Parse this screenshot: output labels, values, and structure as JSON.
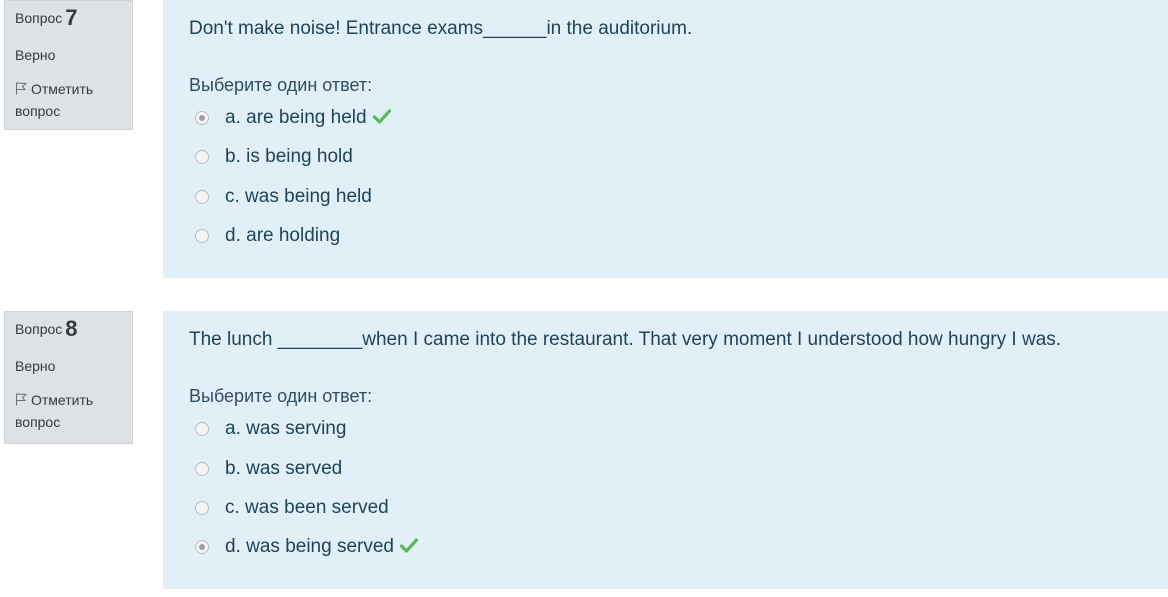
{
  "questions": [
    {
      "label": "Вопрос",
      "number": "7",
      "state": "Верно",
      "flag_label": "Отметить вопрос",
      "text": "Don't make noise! Entrance exams______in the auditorium.",
      "prompt": "Выберите один ответ:",
      "answers": [
        {
          "label": "a. are being held",
          "selected": true,
          "correct": true
        },
        {
          "label": "b. is being hold",
          "selected": false,
          "correct": false
        },
        {
          "label": "c. was being held",
          "selected": false,
          "correct": false
        },
        {
          "label": "d. are holding",
          "selected": false,
          "correct": false
        }
      ]
    },
    {
      "label": "Вопрос",
      "number": "8",
      "state": "Верно",
      "flag_label": "Отметить вопрос",
      "text": "The lunch ________when I came into the restaurant. That very moment I understood how hungry I was.",
      "prompt": "Выберите один ответ:",
      "answers": [
        {
          "label": "a. was serving",
          "selected": false,
          "correct": false
        },
        {
          "label": "b. was served",
          "selected": false,
          "correct": false
        },
        {
          "label": "c. was been served",
          "selected": false,
          "correct": false
        },
        {
          "label": "d. was being served",
          "selected": true,
          "correct": true
        }
      ]
    }
  ],
  "colors": {
    "info_bg": "#dee2e6",
    "content_bg": "#e0f0f6",
    "text": "#1f4458",
    "correct": "#5cb85c"
  },
  "icons": {
    "flag": "flag-icon",
    "correct": "check-icon",
    "radio": "radio-button"
  }
}
